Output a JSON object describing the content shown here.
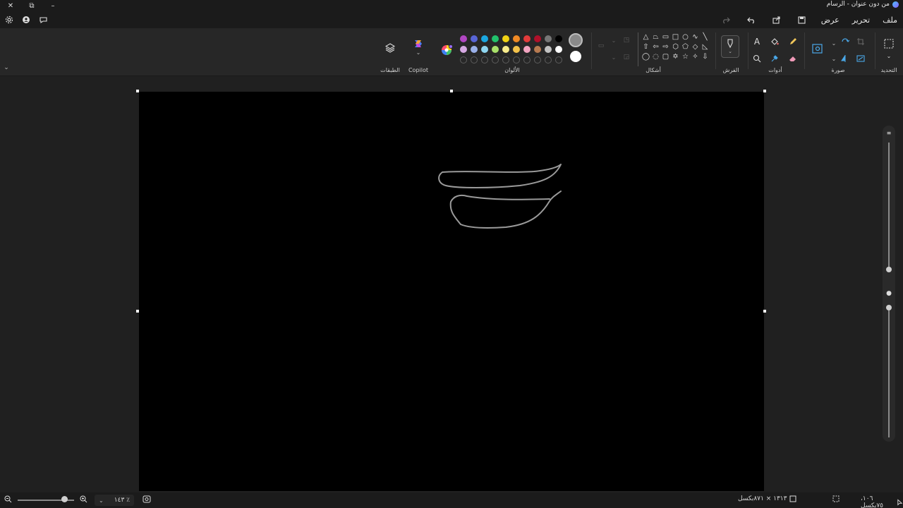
{
  "window": {
    "title": "من دون عنوان - الرسام",
    "controls": {
      "close": "✕",
      "restore": "⧉",
      "minimize": "–"
    }
  },
  "menu": {
    "file": "ملف",
    "edit": "تحرير",
    "view": "عرض"
  },
  "ribbon": {
    "selection_label": "التحديد",
    "image_label": "صورة",
    "tools_label": "أدوات",
    "brushes_label": "الفرش",
    "shapes_label": "أشكال",
    "colors_label": "الألوان",
    "copilot_label": "Copilot",
    "layers_label": "الطبقات",
    "text_tool_glyph": "A",
    "palette": {
      "row1": [
        "#b146c2",
        "#5865d6",
        "#1aa7e0",
        "#21c16b",
        "#f1d214",
        "#f08a24",
        "#e23b3b",
        "#b0102a",
        "#777777",
        "#000000"
      ],
      "row2": [
        "#d6a8e2",
        "#9ab0e8",
        "#8fd6f0",
        "#a8e06a",
        "#f8ec8c",
        "#f4c24a",
        "#f2a4c0",
        "#b77a50",
        "#c2c2c2",
        "#ffffff"
      ],
      "row3_empty_count": 10
    },
    "primary_color": "#8a8a8a",
    "secondary_color": "#ffffff"
  },
  "status": {
    "cursor_position": "١٠٦، ٧٥بكسل",
    "canvas_size": "١٣١٣ × ٨٧١بكسل",
    "zoom": "١٤٣ ٪"
  },
  "drawing": {
    "stroke_color": "#9a9a9a"
  }
}
